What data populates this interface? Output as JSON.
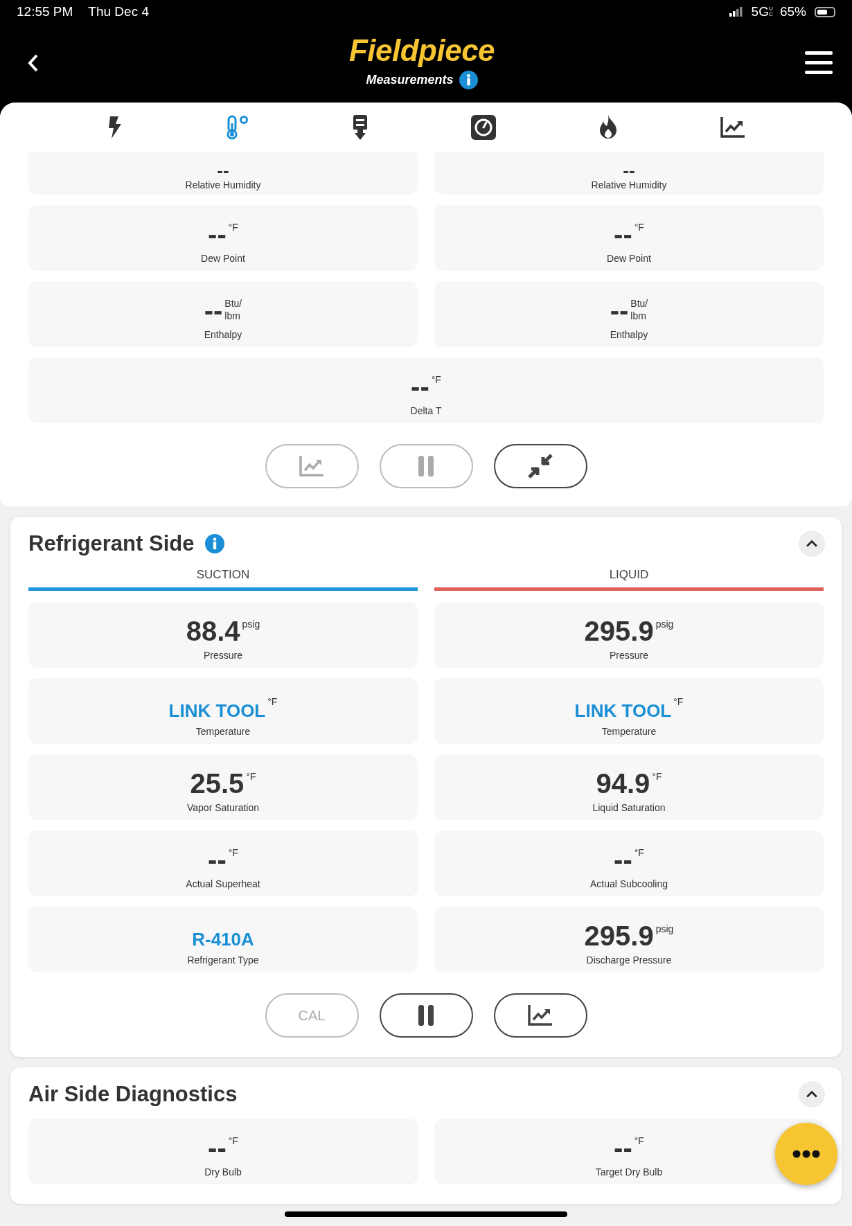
{
  "status_bar": {
    "time": "12:55 PM",
    "date": "Thu Dec 4",
    "network": "5G",
    "network_badge": "UC",
    "battery": "65%"
  },
  "header": {
    "logo": "Fieldpiece",
    "subtitle": "Measurements",
    "info": true
  },
  "tabs": [
    {
      "kind": "bolt",
      "selected": false
    },
    {
      "kind": "thermometer",
      "selected": true
    },
    {
      "kind": "probe",
      "selected": false
    },
    {
      "kind": "gauge",
      "selected": false
    },
    {
      "kind": "flame",
      "selected": false
    },
    {
      "kind": "chart",
      "selected": false
    }
  ],
  "sections": [
    {
      "rows": [
        [
          {
            "value": "--",
            "label": "Relative Humidity"
          },
          {
            "value": "--",
            "label": "Relative Humidity"
          }
        ],
        [
          {
            "value": "--",
            "unit": "°F",
            "label": "Dew Point"
          },
          {
            "value": "--",
            "unit": "°F",
            "label": "Dew Point"
          }
        ],
        [
          {
            "value": "--",
            "unit": "Btu/ lbm",
            "label": "Enthalpy"
          },
          {
            "value": "--",
            "unit": "Btu/ lbm",
            "label": "Enthalpy"
          }
        ],
        [
          {
            "value": "--",
            "unit": "°F",
            "label": "Delta T"
          }
        ]
      ],
      "buttons": [
        {
          "kind": "chart",
          "disabled": true
        },
        {
          "kind": "pause",
          "disabled": true
        },
        {
          "kind": "collapse",
          "disabled": false
        }
      ]
    },
    {
      "title": "Refrigerant Side",
      "info": true,
      "expanded": true,
      "columns": [
        {
          "label": "SUCTION",
          "color": "#2196d8"
        },
        {
          "label": "LIQUID",
          "color": "#e0605c"
        }
      ],
      "rows": [
        [
          {
            "value": "88.4",
            "unit": "psig",
            "label": "Pressure"
          },
          {
            "value": "295.9",
            "unit": "psig",
            "label": "Pressure"
          }
        ],
        [
          {
            "value": "LINK TOOL",
            "unit": "°F",
            "label": "Temperature",
            "link": true
          },
          {
            "value": "LINK TOOL",
            "unit": "°F",
            "label": "Temperature",
            "link": true
          }
        ],
        [
          {
            "value": "25.5",
            "unit": "°F",
            "label": "Vapor Saturation"
          },
          {
            "value": "94.9",
            "unit": "°F",
            "label": "Liquid Saturation"
          }
        ],
        [
          {
            "value": "--",
            "unit": "°F",
            "label": "Actual Superheat"
          },
          {
            "value": "--",
            "unit": "°F",
            "label": "Actual Subcooling"
          }
        ],
        [
          {
            "value": "R-410A",
            "label": "Refrigerant Type",
            "link": true
          },
          {
            "value": "295.9",
            "unit": "psig",
            "label": "Discharge Pressure"
          }
        ]
      ],
      "buttons": [
        {
          "kind": "text",
          "label": "CAL",
          "disabled": true
        },
        {
          "kind": "pause",
          "disabled": false
        },
        {
          "kind": "chart",
          "disabled": false
        }
      ]
    },
    {
      "title": "Air Side Diagnostics",
      "info": false,
      "expanded": true,
      "rows": [
        [
          {
            "value": "--",
            "unit": "°F",
            "label": "Dry Bulb"
          },
          {
            "value": "--",
            "unit": "°F",
            "label": "Target Dry Bulb"
          }
        ]
      ]
    }
  ]
}
